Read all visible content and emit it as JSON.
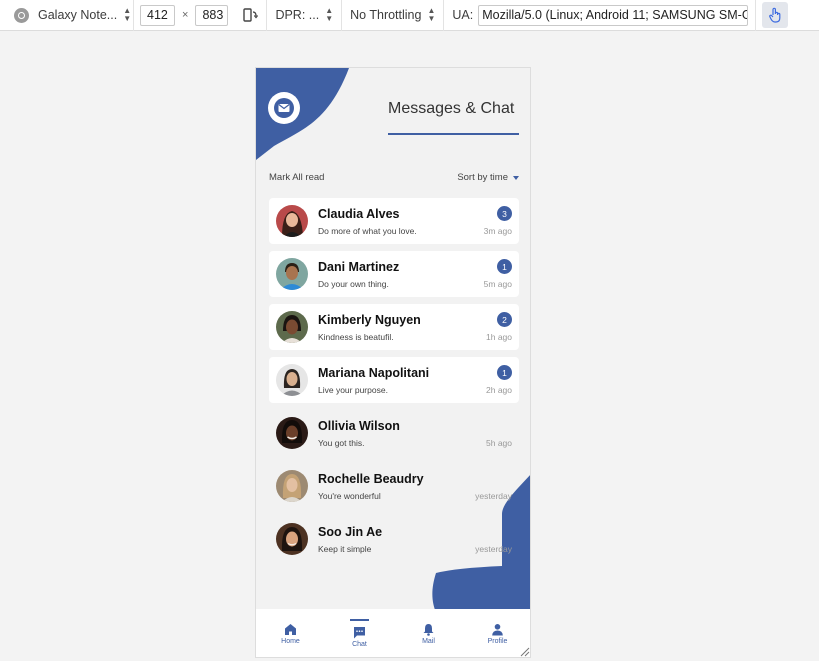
{
  "devtools": {
    "device": "Galaxy Note...",
    "width": "412",
    "times": "×",
    "height": "883",
    "dpr": "DPR: ...",
    "throttle": "No Throttling",
    "ua_label": "UA:",
    "ua_value": "Mozilla/5.0 (Linux; Android 11; SAMSUNG SM-G"
  },
  "header": {
    "title": "Messages & Chat"
  },
  "actions": {
    "mark_all": "Mark All read",
    "sort": "Sort by time"
  },
  "chats": [
    {
      "name": "Claudia Alves",
      "message": "Do more of what you love.",
      "time": "3m ago",
      "badge": "3"
    },
    {
      "name": "Dani Martinez",
      "message": "Do your own thing.",
      "time": "5m ago",
      "badge": "1"
    },
    {
      "name": "Kimberly Nguyen",
      "message": "Kindness is beatufil.",
      "time": "1h ago",
      "badge": "2"
    },
    {
      "name": "Mariana Napolitani",
      "message": "Live your purpose.",
      "time": "2h ago",
      "badge": "1"
    },
    {
      "name": "Ollivia Wilson",
      "message": "You got this.",
      "time": "5h ago",
      "badge": ""
    },
    {
      "name": "Rochelle Beaudry",
      "message": "You're wonderful",
      "time": "yesterday",
      "badge": ""
    },
    {
      "name": "Soo Jin Ae",
      "message": "Keep it simple",
      "time": "yesterday",
      "badge": ""
    }
  ],
  "nav": {
    "home": "Home",
    "chat": "Chat",
    "mail": "Mail",
    "profile": "Profile"
  },
  "colors": {
    "accent": "#3f5fa3",
    "background": "#f2f2f2",
    "card": "#ffffff"
  },
  "icons": {
    "device": "chrome-icon",
    "rotate": "rotate-device-icon",
    "touch": "touch-hand-icon",
    "logo": "mail-icon",
    "home": "home-icon",
    "chat": "chat-bubble-icon",
    "mail": "bell-icon",
    "profile": "person-icon"
  }
}
